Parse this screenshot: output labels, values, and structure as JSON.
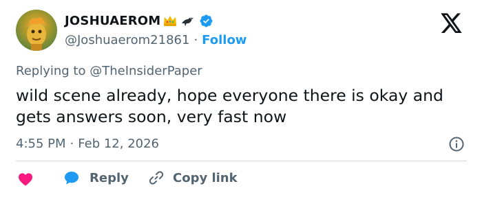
{
  "user": {
    "display_name": "JOSHUAEROM",
    "handle": "@Joshuaerom21861",
    "dot": "·",
    "follow_label": "Follow",
    "avatar_icon": "avatar-image",
    "badge_icons": [
      "crown-icon",
      "crow-icon",
      "verified-badge-icon"
    ]
  },
  "reply_context": {
    "prefix": "Replying to",
    "mention": "@TheInsiderPaper"
  },
  "tweet": {
    "text": "wild scene already, hope everyone there is okay and gets answers soon, very fast now"
  },
  "meta": {
    "time": "4:55 PM",
    "dot": "·",
    "date": "Feb 12, 2026"
  },
  "actions": {
    "reply_label": "Reply",
    "copy_link_label": "Copy link"
  },
  "colors": {
    "accent": "#1d9bf0",
    "like": "#f91880",
    "muted": "#536471",
    "text": "#0f1419"
  }
}
